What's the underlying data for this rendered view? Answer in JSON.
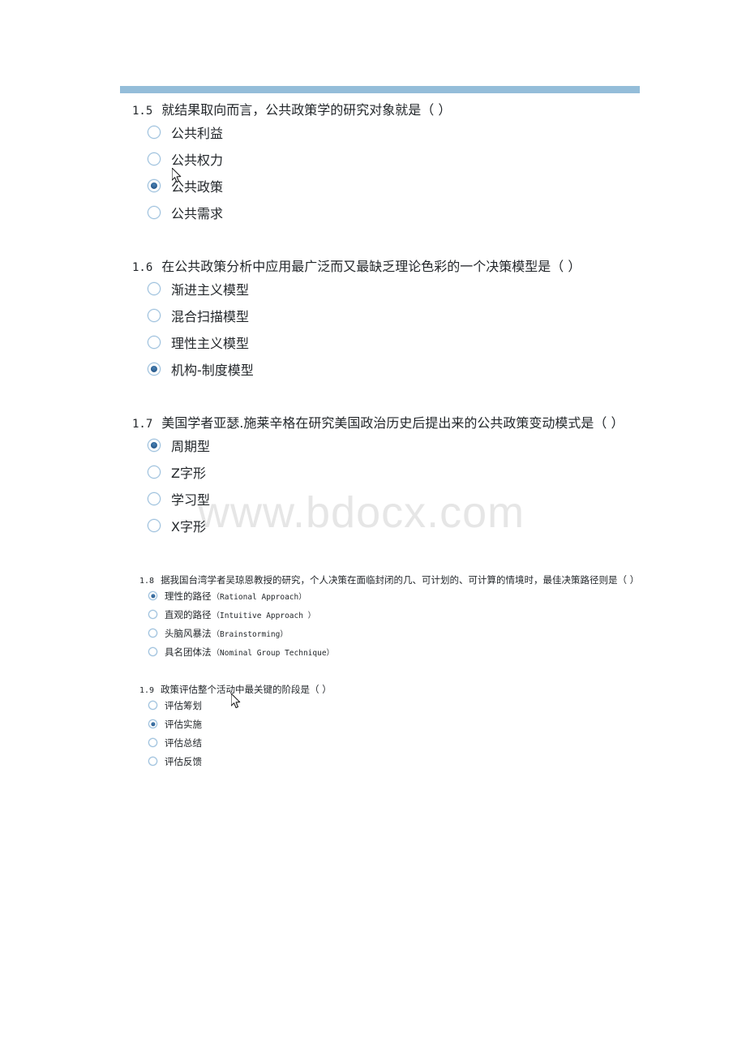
{
  "document": {
    "watermark": "www.bdocx.com",
    "accent_color": "#94bdd9",
    "radio_selected_color": "#2c5f92",
    "text_color": "#23272b"
  },
  "questions": [
    {
      "number": "1.5",
      "text": "就结果取向而言，公共政策学的研究对象就是（ ）",
      "options": [
        {
          "label": "公共利益",
          "en": "",
          "selected": false
        },
        {
          "label": "公共权力",
          "en": "",
          "selected": false
        },
        {
          "label": "公共政策",
          "en": "",
          "selected": true
        },
        {
          "label": "公共需求",
          "en": "",
          "selected": false
        }
      ]
    },
    {
      "number": "1.6",
      "text": "在公共政策分析中应用最广泛而又最缺乏理论色彩的一个决策模型是（ ）",
      "options": [
        {
          "label": "渐进主义模型",
          "en": "",
          "selected": false
        },
        {
          "label": "混合扫描模型",
          "en": "",
          "selected": false
        },
        {
          "label": "理性主义模型",
          "en": "",
          "selected": false
        },
        {
          "label": "机构-制度模型",
          "en": "",
          "selected": true
        }
      ]
    },
    {
      "number": "1.7",
      "text": "美国学者亚瑟.施莱辛格在研究美国政治历史后提出来的公共政策变动模式是（ ）",
      "options": [
        {
          "label": "周期型",
          "en": "",
          "selected": true
        },
        {
          "label": "Z字形",
          "en": "",
          "selected": false
        },
        {
          "label": "学习型",
          "en": "",
          "selected": false
        },
        {
          "label": "X字形",
          "en": "",
          "selected": false
        }
      ]
    },
    {
      "number": "1.8",
      "text": "据我国台湾学者吴琼恩教授的研究，个人决策在面临封闭的几、可计划的、可计算的情境时，最佳决策路径则是（ ）",
      "options": [
        {
          "label": "理性的路径",
          "en": "（Rational Approach）",
          "selected": true
        },
        {
          "label": "直观的路径",
          "en": "（Intuitive Approach ）",
          "selected": false
        },
        {
          "label": "头脑风暴法",
          "en": "（Brainstorming）",
          "selected": false
        },
        {
          "label": "具名团体法",
          "en": "（Nominal Group Technique）",
          "selected": false
        }
      ]
    },
    {
      "number": "1.9",
      "text": "政策评估整个活动中最关键的阶段是（ ）",
      "options": [
        {
          "label": "评估筹划",
          "en": "",
          "selected": false
        },
        {
          "label": "评估实施",
          "en": "",
          "selected": true
        },
        {
          "label": "评估总结",
          "en": "",
          "selected": false
        },
        {
          "label": "评估反馈",
          "en": "",
          "selected": false
        }
      ]
    }
  ]
}
